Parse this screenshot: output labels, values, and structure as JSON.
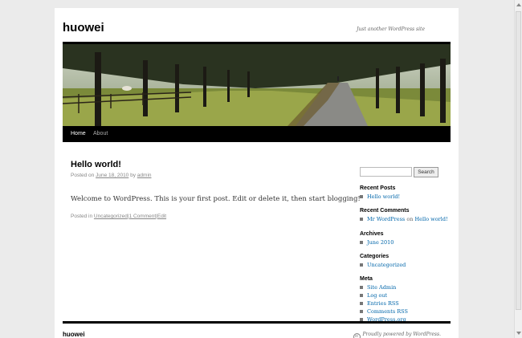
{
  "site": {
    "title": "huowei",
    "description": "Just another WordPress site"
  },
  "nav": {
    "items": [
      {
        "label": "Home",
        "current": true
      },
      {
        "label": "About",
        "current": false
      }
    ]
  },
  "post": {
    "title": "Hello world!",
    "meta_prefix": "Posted on",
    "date": "June 18, 2010",
    "by": "by",
    "author": "admin",
    "body": "Welcome to WordPress. This is your first post. Edit or delete it, then start blogging!",
    "footer_prefix": "Posted in",
    "category": "Uncategorized",
    "comments": "1 Comment",
    "edit": "Edit",
    "separator": "|"
  },
  "sidebar": {
    "search_value": "",
    "search_button": "Search",
    "recent_posts": {
      "heading": "Recent Posts",
      "items": [
        "Hello world!"
      ]
    },
    "recent_comments": {
      "heading": "Recent Comments",
      "author": "Mr WordPress",
      "on": "on",
      "post": "Hello world!"
    },
    "archives": {
      "heading": "Archives",
      "items": [
        "June 2010"
      ]
    },
    "categories": {
      "heading": "Categories",
      "items": [
        "Uncategorized"
      ]
    },
    "meta": {
      "heading": "Meta",
      "items": [
        "Site Admin",
        "Log out",
        "Entries RSS",
        "Comments RSS",
        "WordPress.org"
      ]
    }
  },
  "footer": {
    "title": "huowei",
    "credit": "Proudly powered by WordPress."
  },
  "colors": {
    "link": "#0066aa",
    "nav_bg": "#000000",
    "page_bg": "#ebebeb"
  }
}
